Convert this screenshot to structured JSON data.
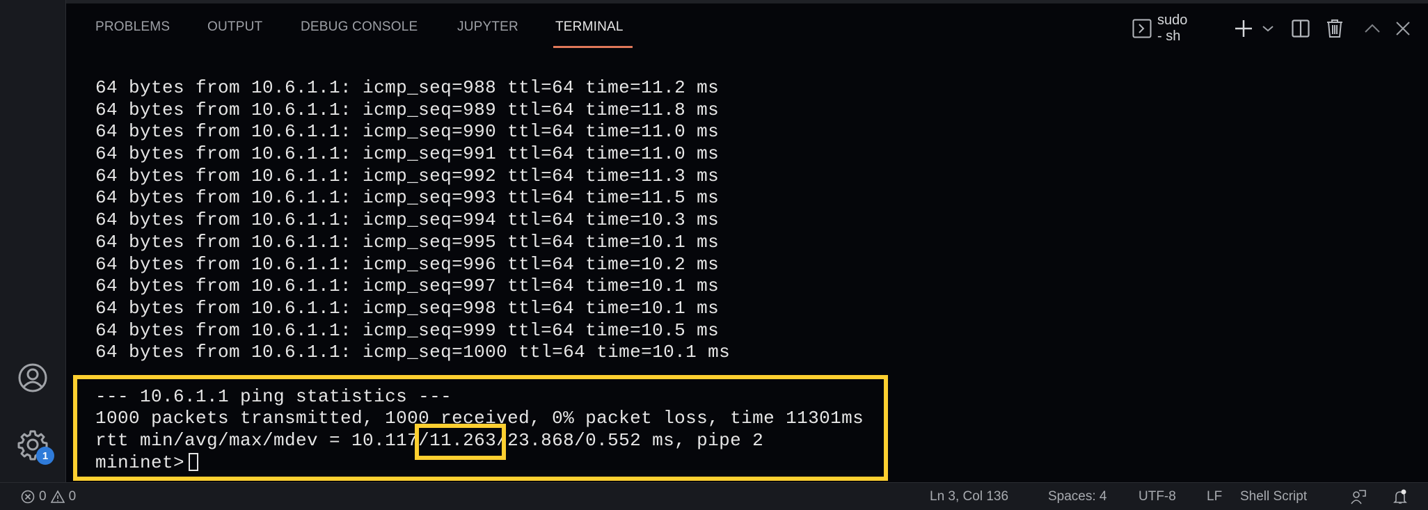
{
  "panel": {
    "tabs": [
      {
        "label": "PROBLEMS",
        "active": false
      },
      {
        "label": "OUTPUT",
        "active": false
      },
      {
        "label": "DEBUG CONSOLE",
        "active": false
      },
      {
        "label": "JUPYTER",
        "active": false
      },
      {
        "label": "TERMINAL",
        "active": true
      }
    ],
    "terminal_name": "sudo - sh",
    "accent_color": "#e0785a"
  },
  "terminal": {
    "lines": [
      "64 bytes from 10.6.1.1: icmp_seq=988 ttl=64 time=11.2 ms",
      "64 bytes from 10.6.1.1: icmp_seq=989 ttl=64 time=11.8 ms",
      "64 bytes from 10.6.1.1: icmp_seq=990 ttl=64 time=11.0 ms",
      "64 bytes from 10.6.1.1: icmp_seq=991 ttl=64 time=11.0 ms",
      "64 bytes from 10.6.1.1: icmp_seq=992 ttl=64 time=11.3 ms",
      "64 bytes from 10.6.1.1: icmp_seq=993 ttl=64 time=11.5 ms",
      "64 bytes from 10.6.1.1: icmp_seq=994 ttl=64 time=10.3 ms",
      "64 bytes from 10.6.1.1: icmp_seq=995 ttl=64 time=10.1 ms",
      "64 bytes from 10.6.1.1: icmp_seq=996 ttl=64 time=10.2 ms",
      "64 bytes from 10.6.1.1: icmp_seq=997 ttl=64 time=10.1 ms",
      "64 bytes from 10.6.1.1: icmp_seq=998 ttl=64 time=10.1 ms",
      "64 bytes from 10.6.1.1: icmp_seq=999 ttl=64 time=10.5 ms",
      "64 bytes from 10.6.1.1: icmp_seq=1000 ttl=64 time=10.1 ms",
      "",
      "--- 10.6.1.1 ping statistics ---",
      "1000 packets transmitted, 1000 received, 0% packet loss, time 11301ms",
      "rtt min/avg/max/mdev = 10.117/11.263/23.868/0.552 ms, pipe 2"
    ],
    "prompt": "mininet>",
    "highlight_color": "#fdcf30"
  },
  "activity_bar": {
    "settings_badge": "1"
  },
  "status_bar": {
    "errors": "0",
    "warnings": "0",
    "position": "Ln 3, Col 136",
    "indentation": "Spaces: 4",
    "encoding": "UTF-8",
    "eol": "LF",
    "language": "Shell Script"
  }
}
